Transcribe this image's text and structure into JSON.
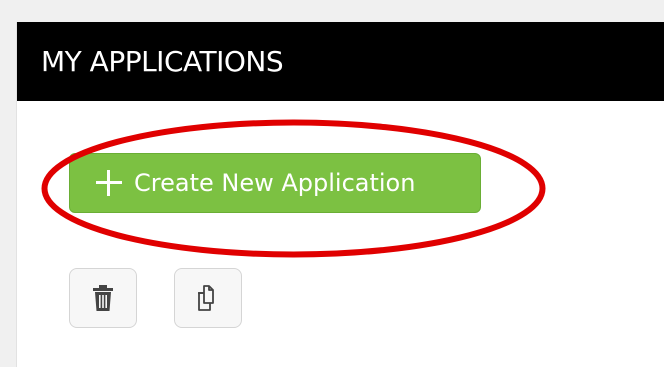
{
  "header": {
    "title": "MY APPLICATIONS"
  },
  "actions": {
    "create_label": "Create New Application",
    "create_icon": "plus-icon",
    "delete_icon": "trash-icon",
    "copy_icon": "copy-icon"
  },
  "annotation": {
    "type": "ellipse-highlight",
    "color": "#e00000"
  },
  "colors": {
    "header_bg": "#000000",
    "button_green": "#7cc142"
  }
}
